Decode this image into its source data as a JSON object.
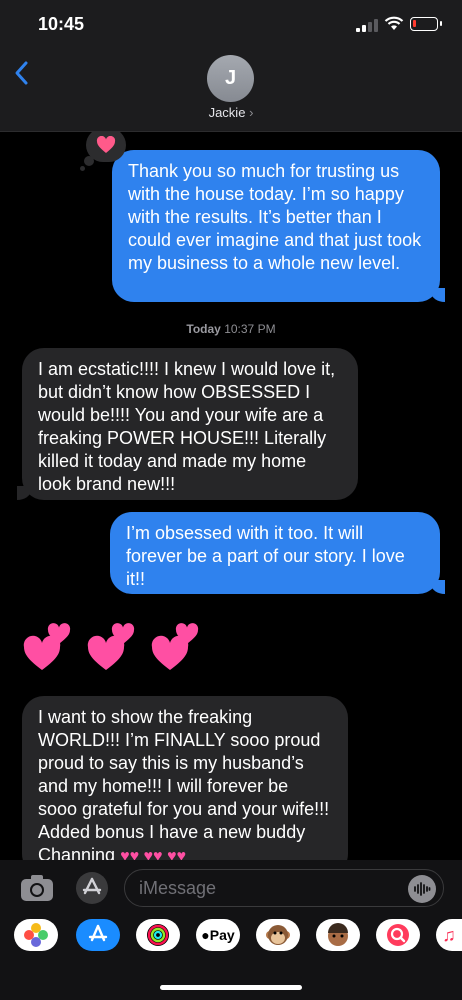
{
  "status_bar": {
    "time": "10:45"
  },
  "header": {
    "avatar_initial": "J",
    "contact_name": "Jackie",
    "chevron": "›"
  },
  "messages": [
    {
      "from": "me",
      "text": "Thank you so much for trusting us with the house today. I’m so happy with the results. It’s better than I could ever imagine and that just took my business to a whole new level.",
      "tapback": "heart"
    },
    {
      "from": "them",
      "text": "I am ecstatic!!!! I knew I would love it, but didn’t know how OBSESSED I would be!!!! You and your wife are a freaking POWER HOUSE!!! Literally killed it today and made my home look brand new!!!"
    },
    {
      "from": "me",
      "text": "I’m obsessed with it too. It will forever be a part of our story. I love it!!"
    },
    {
      "from": "them",
      "emoji_only": "two-hearts x3"
    },
    {
      "from": "them",
      "text": " I want to show the freaking WORLD!!! I’m FINALLY sooo proud proud to say this is my husband’s and my home!!! I will forever be sooo grateful for you and your wife!!! Added bonus I have a new buddy Channing"
    }
  ],
  "timestamp": {
    "day": "Today",
    "time": "10:37 PM"
  },
  "input": {
    "placeholder": "iMessage"
  },
  "app_drawer": [
    "photos-icon",
    "app-store-icon",
    "activity-icon",
    "apple-pay-icon",
    "monkey-memoji-icon",
    "memoji-icon",
    "search-images-icon",
    "music-icon"
  ],
  "apple_pay_label": "Pay",
  "colors": {
    "sent": "#2f82ee",
    "received": "#262628",
    "background": "#000000",
    "heart": "#ff5a8a"
  }
}
